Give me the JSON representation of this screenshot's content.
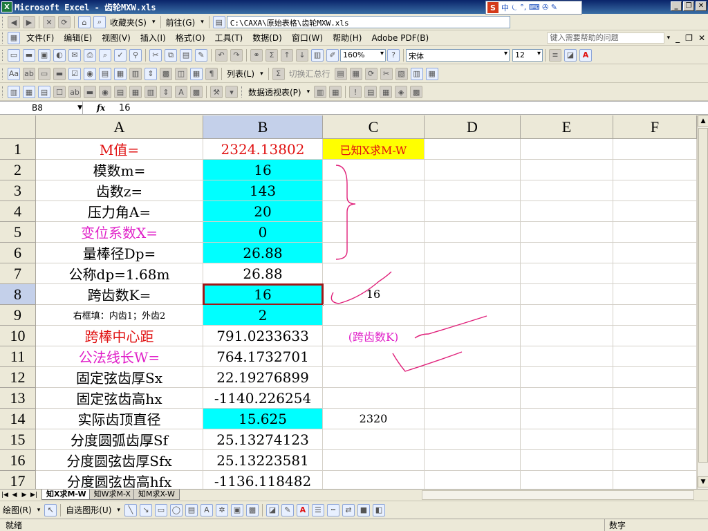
{
  "titlebar": {
    "app_icon": "X",
    "title": "Microsoft Excel - 齿轮MXW.xls"
  },
  "ime": {
    "logo": "S",
    "mode": "中",
    "extra": "⏾ °, ⌨ ✇ ✎"
  },
  "window_controls": {
    "minimize": "_",
    "restore": "❐",
    "close": "✕"
  },
  "toolbar_nav": {
    "favorites_label": "收藏夹(S)",
    "goto_label": "前往(G)",
    "address": "C:\\CAXA\\原始表格\\齿轮MXW.xls"
  },
  "menu": {
    "items": [
      "文件(F)",
      "编辑(E)",
      "视图(V)",
      "插入(I)",
      "格式(O)",
      "工具(T)",
      "数据(D)",
      "窗口(W)",
      "帮助(H)",
      "Adobe PDF(B)"
    ],
    "help_placeholder": "键入需要帮助的问题"
  },
  "toolbar_std": {
    "zoom": "160%",
    "font_name": "宋体",
    "font_size": "12"
  },
  "toolbar_forms": {
    "list_label": "列表(L)",
    "toggle_total_label": "切换汇总行"
  },
  "toolbar_pivot": {
    "pivot_label": "数据透视表(P)"
  },
  "formula_bar": {
    "name_box": "B8",
    "fx_label": "fx",
    "value": "16"
  },
  "columns": [
    "A",
    "B",
    "C",
    "D",
    "E",
    "F"
  ],
  "rows": [
    {
      "num": "1",
      "a": "M值=",
      "b": "2324.13802",
      "c": "已知X求M-W"
    },
    {
      "num": "2",
      "a": "模数m=",
      "b": "16",
      "c": ""
    },
    {
      "num": "3",
      "a": "齿数z=",
      "b": "143",
      "c": ""
    },
    {
      "num": "4",
      "a": "压力角A=",
      "b": "20",
      "c": ""
    },
    {
      "num": "5",
      "a": "变位系数X=",
      "b": "0",
      "c": ""
    },
    {
      "num": "6",
      "a": "量棒径Dp=",
      "b": "26.88",
      "c": ""
    },
    {
      "num": "7",
      "a": "公称dp=1.68m",
      "b": "26.88",
      "c": ""
    },
    {
      "num": "8",
      "a": "跨齿数K=",
      "b": "16",
      "c": "16"
    },
    {
      "num": "9",
      "a": "右框填：内齿1；外齿2",
      "b": "2",
      "c": ""
    },
    {
      "num": "10",
      "a": "跨棒中心距",
      "b": "791.0233633",
      "c": "(跨齿数K)"
    },
    {
      "num": "11",
      "a": "公法线长W=",
      "b": "764.1732701",
      "c": ""
    },
    {
      "num": "12",
      "a": "固定弦齿厚Sx",
      "b": "22.19276899",
      "c": ""
    },
    {
      "num": "13",
      "a": "固定弦齿高hx",
      "b": "-1140.226254",
      "c": ""
    },
    {
      "num": "14",
      "a": "实际齿顶直径",
      "b": "15.625",
      "c": "2320"
    },
    {
      "num": "15",
      "a": "分度圆弧齿厚Sf",
      "b": "25.13274123",
      "c": ""
    },
    {
      "num": "16",
      "a": "分度圆弦齿厚Sfx",
      "b": "25.13223581",
      "c": ""
    },
    {
      "num": "17",
      "a": "分度圆弦齿高hfx",
      "b": "-1136.118482",
      "c": ""
    }
  ],
  "sheet_tabs": [
    "知X求M-W",
    "知W求M-X",
    "知M求X-W"
  ],
  "draw_toolbar": {
    "draw_label": "绘图(R)",
    "autoshape_label": "自选图形(U)"
  },
  "status": {
    "left": "就绪",
    "right": "数字"
  },
  "colors": {
    "cyan": "#00ffff",
    "yellow": "#ffff00",
    "red": "#e01010",
    "magenta": "#e020c8",
    "annotation": "#e0207a"
  }
}
